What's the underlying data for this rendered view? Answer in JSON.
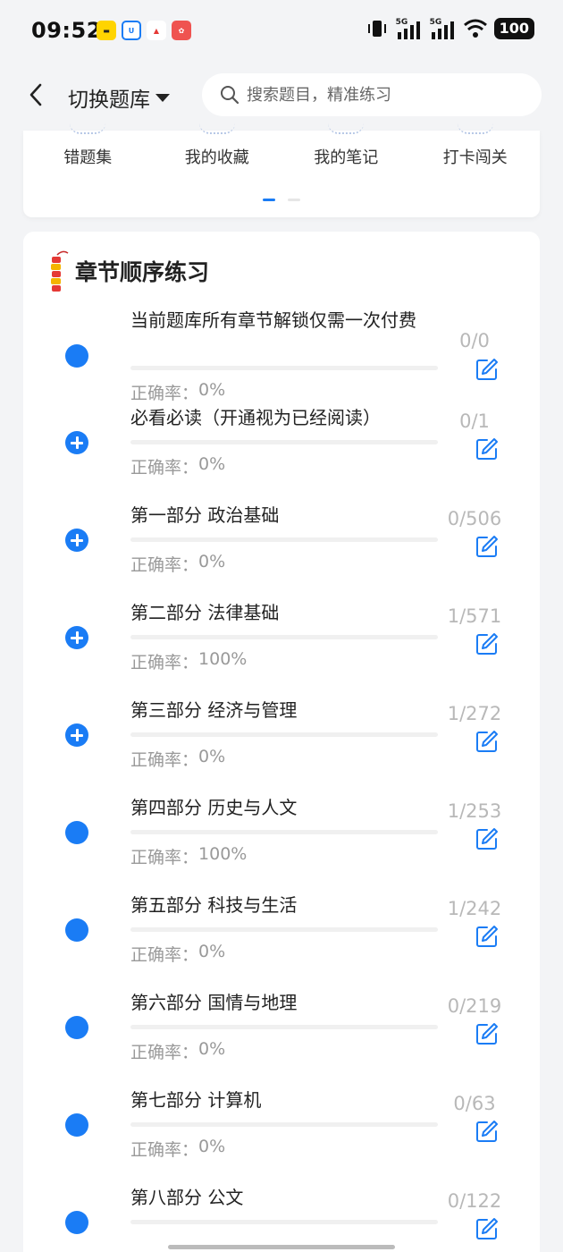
{
  "status_bar": {
    "time": "09:52",
    "battery": "100",
    "network_1": "5G",
    "network_2": "5G"
  },
  "header": {
    "back_icon": "chevron-left-icon",
    "title": "切换题库",
    "search_placeholder": "搜索题目，精准练习"
  },
  "quick_links": [
    {
      "label": "错题集"
    },
    {
      "label": "我的收藏"
    },
    {
      "label": "我的笔记"
    },
    {
      "label": "打卡闯关"
    }
  ],
  "chapter_section": {
    "title": "章节顺序练习",
    "accuracy_prefix": "正确率：",
    "items": [
      {
        "name": "当前题库所有章节解锁仅需一次付费",
        "accuracy": "0%",
        "count": "0/0",
        "icon": "filled-dot-icon",
        "progress": 0
      },
      {
        "name": "必看必读（开通视为已经阅读）",
        "accuracy": "0%",
        "count": "0/1",
        "icon": "plus-circle-icon",
        "progress": 0
      },
      {
        "name": "第一部分 政治基础",
        "accuracy": "0%",
        "count": "0/506",
        "icon": "plus-circle-icon",
        "progress": 0
      },
      {
        "name": "第二部分 法律基础",
        "accuracy": "100%",
        "count": "1/571",
        "icon": "plus-circle-icon",
        "progress": 0
      },
      {
        "name": "第三部分 经济与管理",
        "accuracy": "0%",
        "count": "1/272",
        "icon": "plus-circle-icon",
        "progress": 0
      },
      {
        "name": "第四部分 历史与人文",
        "accuracy": "100%",
        "count": "1/253",
        "icon": "filled-dot-icon",
        "progress": 0
      },
      {
        "name": "第五部分 科技与生活",
        "accuracy": "0%",
        "count": "1/242",
        "icon": "filled-dot-icon",
        "progress": 0
      },
      {
        "name": "第六部分 国情与地理",
        "accuracy": "0%",
        "count": "0/219",
        "icon": "filled-dot-icon",
        "progress": 0
      },
      {
        "name": "第七部分 计算机",
        "accuracy": "0%",
        "count": "0/63",
        "icon": "filled-dot-icon",
        "progress": 0
      },
      {
        "name": "第八部分 公文",
        "accuracy": "",
        "count": "0/122",
        "icon": "filled-dot-icon",
        "progress": 0
      }
    ]
  },
  "colors": {
    "accent": "#1a7cf5",
    "background": "#f3f4f6",
    "muted_text": "#999999"
  }
}
